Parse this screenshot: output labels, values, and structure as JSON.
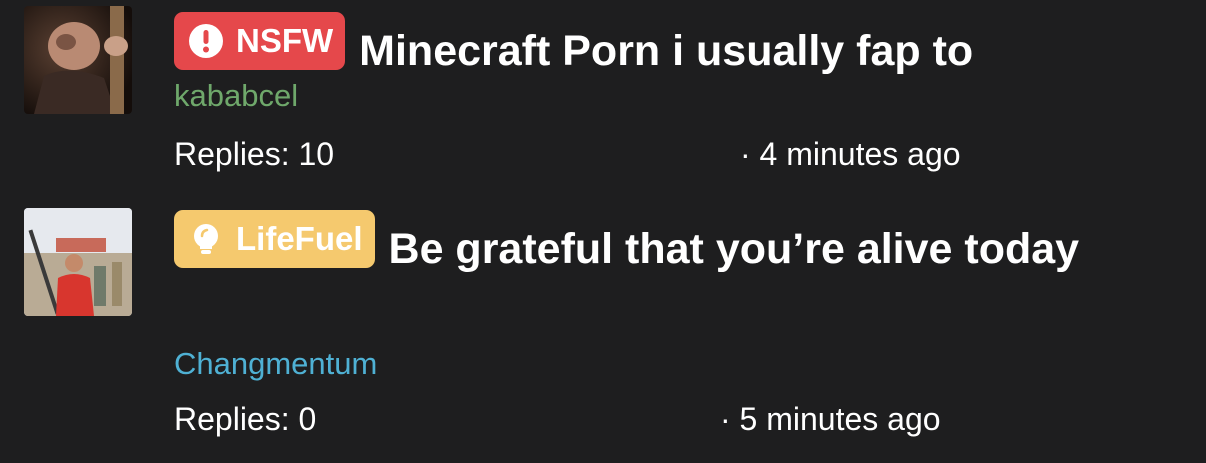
{
  "threads": [
    {
      "tag": {
        "label": "NSFW",
        "icon": "exclamation-circle-icon",
        "color": "#e5484b"
      },
      "title": "Minecraft Porn i usually fap to",
      "author": {
        "name": "kababcel",
        "color": "#6fa86b"
      },
      "replies_text": "Replies: 10",
      "time_text": "· 4 minutes ago"
    },
    {
      "tag": {
        "label": "LifeFuel",
        "icon": "lightbulb-icon",
        "color": "#f5c96e"
      },
      "title": "Be grateful that you’re alive today",
      "author": {
        "name": "Changmentum",
        "color": "#4fb1d4"
      },
      "replies_text": "Replies: 0",
      "time_text": "· 5 minutes ago"
    }
  ]
}
